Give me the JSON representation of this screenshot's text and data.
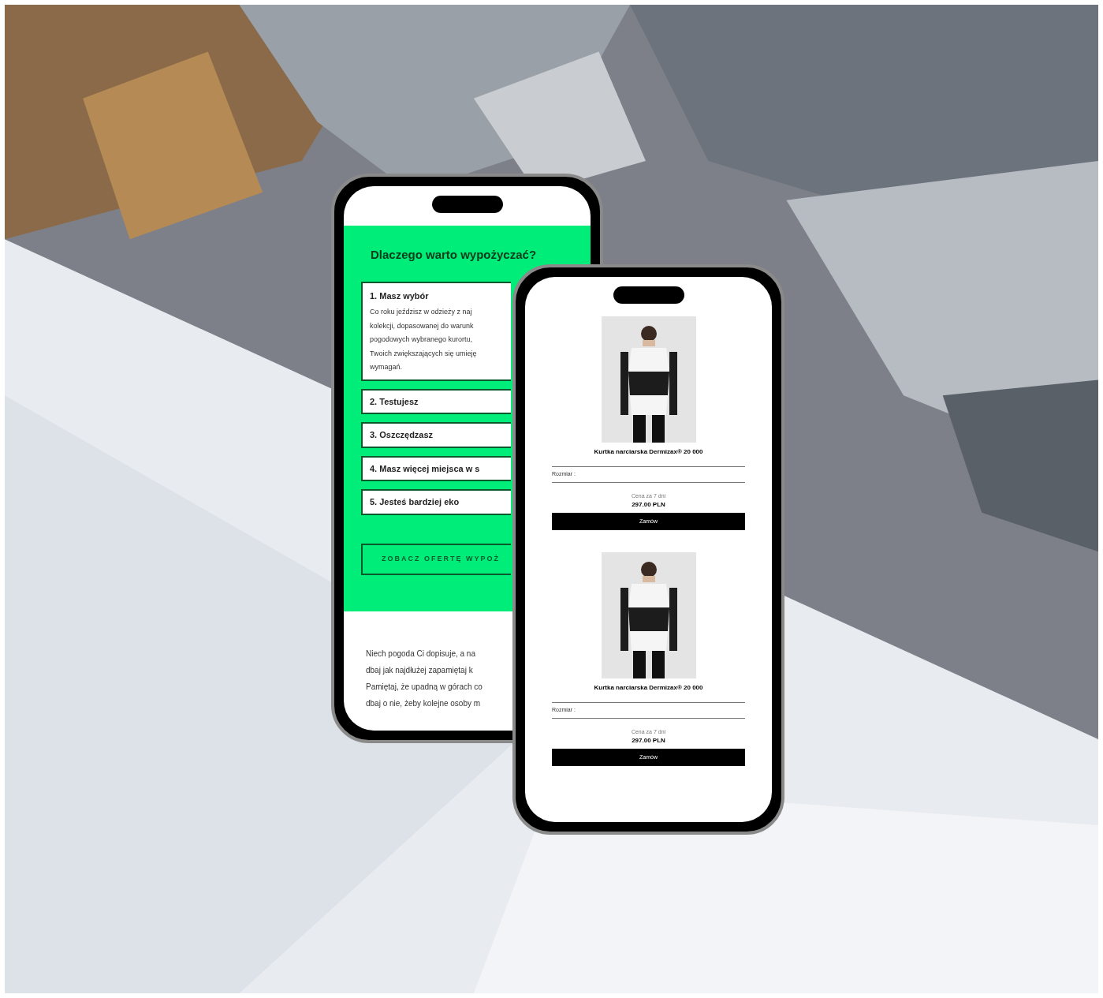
{
  "left_phone": {
    "heading": "Dlaczego warto wypożyczać?",
    "reasons": [
      {
        "title": "1. Masz wybór",
        "expanded": true,
        "body": [
          "Co roku jeździsz w odzieży z naj",
          "kolekcji, dopasowanej do warunk",
          "pogodowych wybranego kurortu,",
          "Twoich zwiększających się umieję",
          "wymagań."
        ]
      },
      {
        "title": "2. Testujesz",
        "expanded": false
      },
      {
        "title": "3. Oszczędzasz",
        "expanded": false
      },
      {
        "title": "4. Masz więcej miejsca w s",
        "expanded": false
      },
      {
        "title": "5. Jesteś bardziej eko",
        "expanded": false
      }
    ],
    "cta": "ZOBACZ OFERTĘ WYPOŻ",
    "paragraph": [
      "Niech pogoda Ci dopisuje, a na",
      "dbaj jak najdłużej zapamiętaj k",
      "Pamiętaj, że upadną w górach co",
      "dbaj o nie, żeby kolejne osoby m"
    ]
  },
  "right_phone": {
    "products": [
      {
        "name": "Kurtka narciarska Dermizax® 20 000",
        "size_label": "Rozmiar :",
        "price_label": "Cena za 7 dni",
        "price": "297.00 PLN",
        "button": "Zamów"
      },
      {
        "name": "Kurtka narciarska Dermizax® 20 000",
        "size_label": "Rozmiar :",
        "price_label": "Cena za 7 dni",
        "price": "297.00 PLN",
        "button": "Zamów"
      }
    ]
  }
}
